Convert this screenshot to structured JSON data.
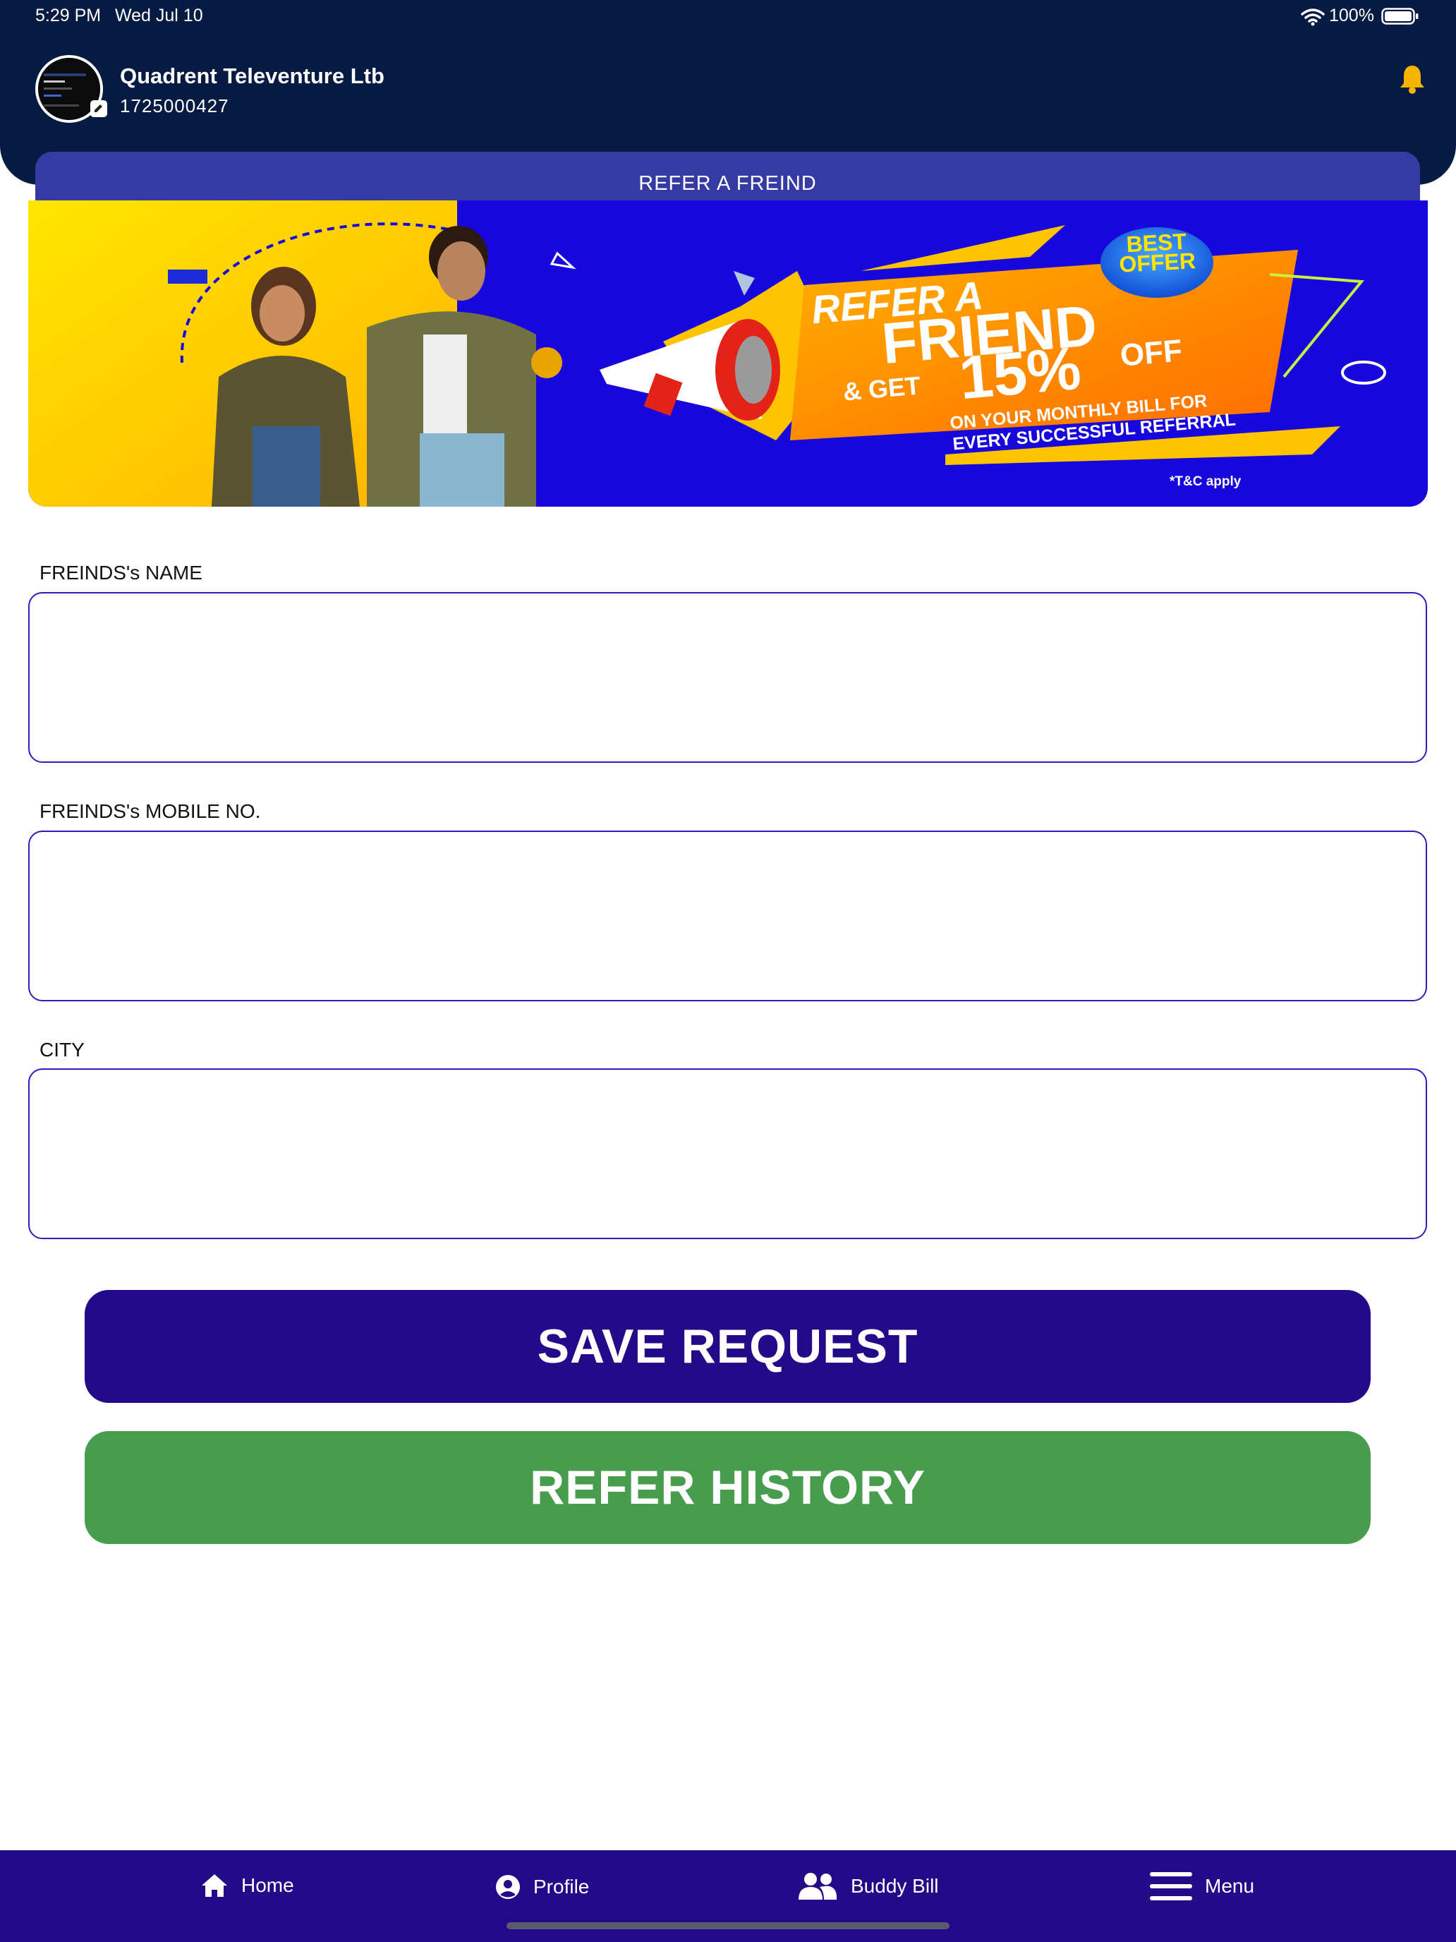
{
  "status_bar": {
    "time": "5:29 PM",
    "date": "Wed Jul 10",
    "battery": "100%"
  },
  "header": {
    "user_name": "Quadrent Televenture Ltb",
    "phone": "1725000427",
    "icons": [
      "avatar",
      "edit-badge-icon",
      "bell-icon"
    ]
  },
  "page_title": "REFER A FREIND",
  "banner": {
    "badge_line1": "BEST",
    "badge_line2": "OFFER",
    "headline1": "REFER A",
    "headline2": "FRIEND",
    "get": "& GET",
    "discount": "15%",
    "off": "OFF",
    "sub1": "ON YOUR MONTHLY BILL FOR",
    "sub2": "EVERY SUCCESSFUL REFERRAL",
    "tc": "*T&C apply"
  },
  "form": {
    "name_label": "FREINDS's NAME",
    "name_value": "",
    "mobile_label": "FREINDS's MOBILE NO.",
    "mobile_value": "",
    "city_label": "CITY",
    "city_value": ""
  },
  "buttons": {
    "save": "SAVE REQUEST",
    "history": "REFER HISTORY"
  },
  "nav": {
    "home": "Home",
    "profile": "Profile",
    "buddy_bill": "Buddy Bill",
    "menu": "Menu"
  },
  "colors": {
    "header_bg": "#061a42",
    "title_bar": "#363ba3",
    "primary": "#220a88",
    "success": "#479c4e",
    "input_border": "#2a1fb9",
    "bell": "#f5b400"
  }
}
